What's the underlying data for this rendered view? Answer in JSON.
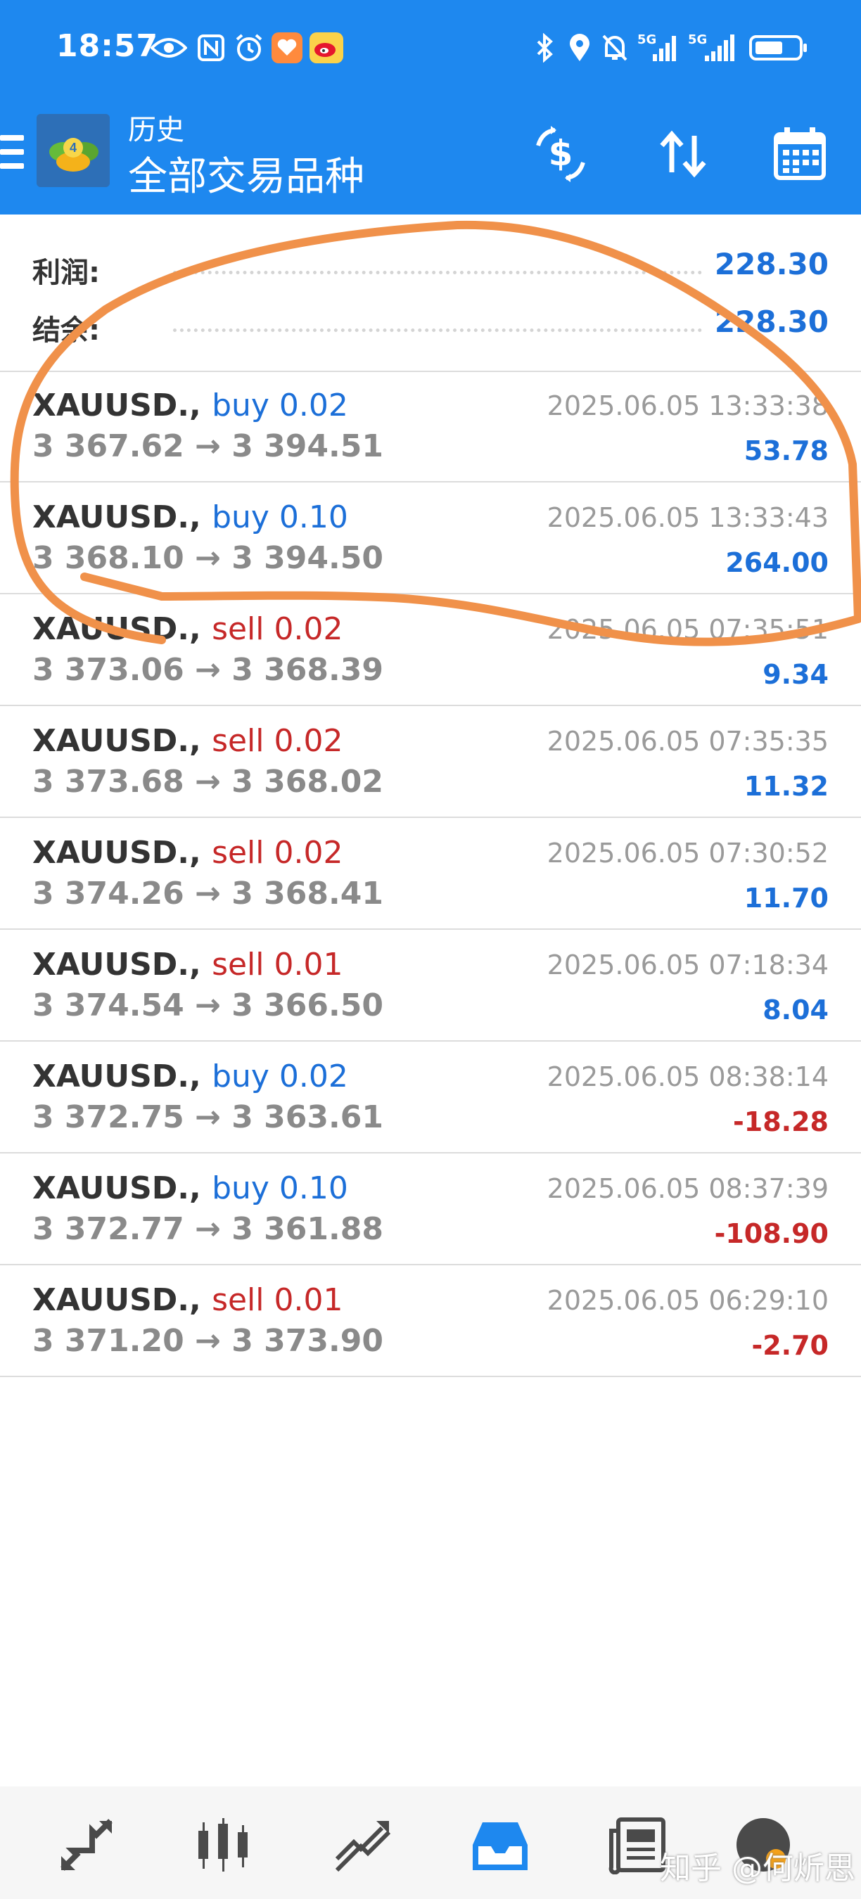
{
  "status_bar": {
    "time": "18:57",
    "icons": [
      "eye-icon",
      "nfc-icon",
      "alarm-icon",
      "heart-app-icon",
      "weibo-icon",
      "bluetooth-icon",
      "location-icon",
      "mute-icon",
      "signal-5g-icon",
      "signal-5g-icon",
      "battery-icon"
    ],
    "signal_1": "5G",
    "signal_2": "5G"
  },
  "toolbar": {
    "title": "历史",
    "subtitle": "全部交易品种"
  },
  "summary": {
    "profit_label": "利润:",
    "profit_value": "228.30",
    "balance_label": "结余:",
    "balance_value": "228.30"
  },
  "deals": [
    {
      "symbol": "XAUUSD.,",
      "type": "buy",
      "volume": "0.02",
      "prices": "3 367.62 → 3 394.51",
      "time": "2025.06.05 13:33:38",
      "profit": "53.78"
    },
    {
      "symbol": "XAUUSD.,",
      "type": "buy",
      "volume": "0.10",
      "prices": "3 368.10 → 3 394.50",
      "time": "2025.06.05 13:33:43",
      "profit": "264.00"
    },
    {
      "symbol": "XAUUSD.,",
      "type": "sell",
      "volume": "0.02",
      "prices": "3 373.06 → 3 368.39",
      "time": "2025.06.05 07:35:51",
      "profit": "9.34"
    },
    {
      "symbol": "XAUUSD.,",
      "type": "sell",
      "volume": "0.02",
      "prices": "3 373.68 → 3 368.02",
      "time": "2025.06.05 07:35:35",
      "profit": "11.32"
    },
    {
      "symbol": "XAUUSD.,",
      "type": "sell",
      "volume": "0.02",
      "prices": "3 374.26 → 3 368.41",
      "time": "2025.06.05 07:30:52",
      "profit": "11.70"
    },
    {
      "symbol": "XAUUSD.,",
      "type": "sell",
      "volume": "0.01",
      "prices": "3 374.54 → 3 366.50",
      "time": "2025.06.05 07:18:34",
      "profit": "8.04"
    },
    {
      "symbol": "XAUUSD.,",
      "type": "buy",
      "volume": "0.02",
      "prices": "3 372.75 → 3 363.61",
      "time": "2025.06.05 08:38:14",
      "profit": "-18.28"
    },
    {
      "symbol": "XAUUSD.,",
      "type": "buy",
      "volume": "0.10",
      "prices": "3 372.77 → 3 361.88",
      "time": "2025.06.05 08:37:39",
      "profit": "-108.90"
    },
    {
      "symbol": "XAUUSD.,",
      "type": "sell",
      "volume": "0.01",
      "prices": "3 371.20 → 3 373.90",
      "time": "2025.06.05 06:29:10",
      "profit": "-2.70"
    }
  ],
  "colors": {
    "toolbar": "#1e88ef",
    "buy": "#1c6fd8",
    "sell": "#c62828",
    "positive": "#1c6fd8",
    "negative": "#c62828",
    "annotation": "#f0914a"
  },
  "bottom_nav": [
    {
      "icon": "quotes-icon"
    },
    {
      "icon": "chart-icon"
    },
    {
      "icon": "trade-icon"
    },
    {
      "icon": "history-icon",
      "active": true
    },
    {
      "icon": "news-icon"
    },
    {
      "icon": "settings-icon"
    }
  ],
  "watermark": "知乎 @何炘思"
}
